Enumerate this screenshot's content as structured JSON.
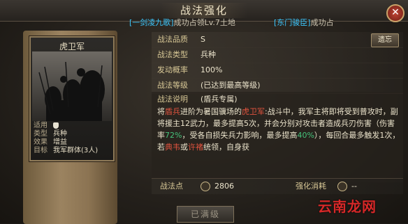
{
  "header": {
    "title": "战法强化"
  },
  "marquee": [
    {
      "tag": "[一剑凌九歌]",
      "text": "成功占领Lv.7土地"
    },
    {
      "tag": "[东门骏臣]",
      "text": "成功占"
    }
  ],
  "card": {
    "name": "虎卫军",
    "rows": [
      {
        "k": "适用",
        "v": ""
      },
      {
        "k": "类型",
        "v": "兵种"
      },
      {
        "k": "效果",
        "v": "增益"
      },
      {
        "k": "目标",
        "v": "我军群体(3人)"
      }
    ]
  },
  "details": {
    "quality": {
      "label": "战法品质",
      "value": "S",
      "button": "遗忘"
    },
    "type": {
      "label": "战法类型",
      "value": "兵种"
    },
    "rate": {
      "label": "发动概率",
      "value": "100%"
    },
    "level": {
      "label": "战法等级",
      "value": "(已达到最高等级)"
    },
    "desc": {
      "label": "战法说明",
      "subtitle": "(盾兵专属)",
      "p1": "将",
      "p2": "盾兵",
      "p3": "进阶为暑国骥场的",
      "p4": "虎卫军",
      "p5": ":战斗中，我军主将即将受到普攻时，副将援主12武力，最多提高5次，并会分别对攻击者造成兵刃伤害（伤害率",
      "p6": "72%",
      "p7": "，受各自损失兵力影响，最多提高",
      "p8": "40%",
      "p9": "），每回合最多触发1次，若",
      "p10": "典韦",
      "p11": "或",
      "p12": "许褚",
      "p13": "统领，自身获"
    }
  },
  "points": {
    "label1": "战法点",
    "value1": "2806",
    "label2": "强化消耗",
    "value2": "--"
  },
  "bottom_button": "已满级",
  "watermark": "云南龙网",
  "colors": {
    "accent_red": "#e0533e",
    "accent_green": "#45c27a",
    "accent_cyan": "#3cc8ff"
  }
}
